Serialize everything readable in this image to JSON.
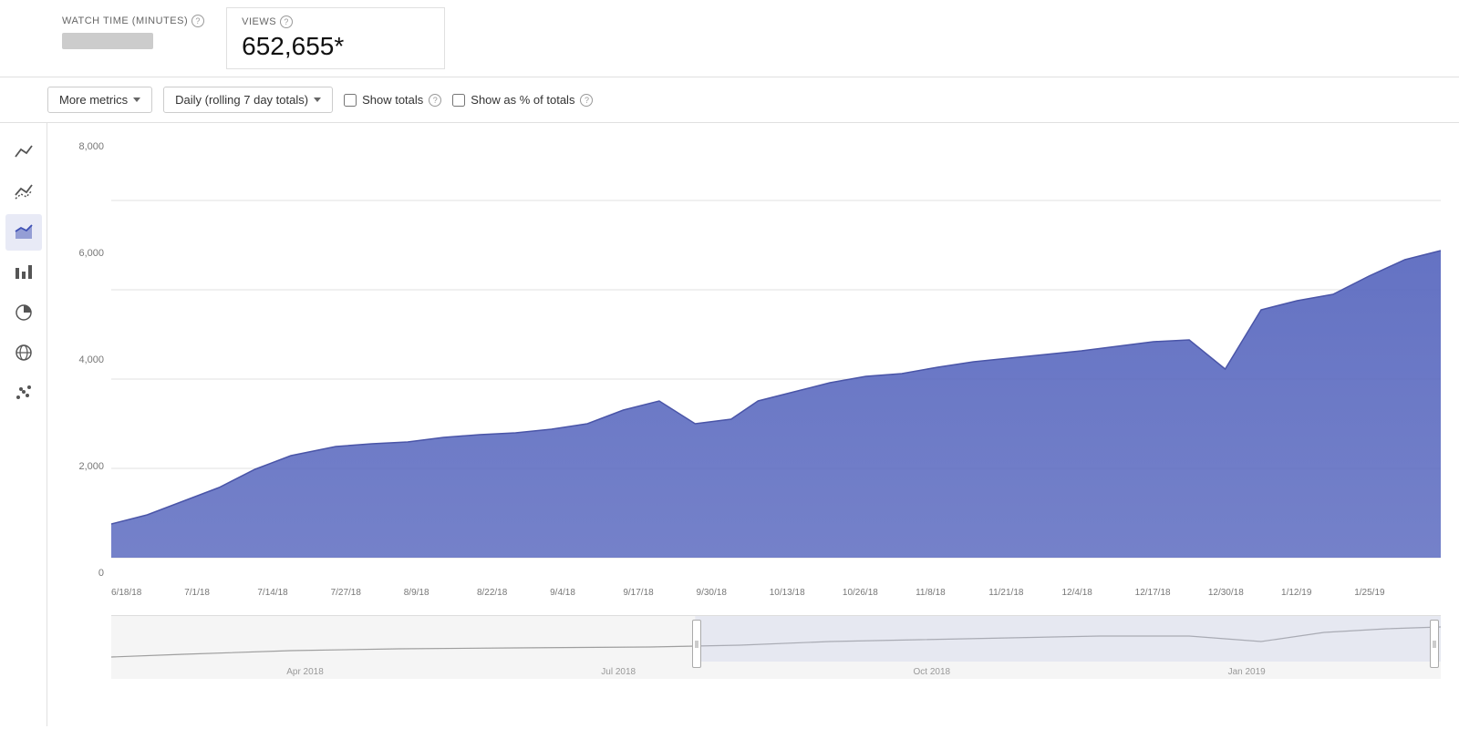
{
  "metrics": {
    "watch_time": {
      "title": "WATCH TIME (MINUTES)",
      "value_placeholder": true
    },
    "views": {
      "title": "VIEWS",
      "value": "652,655*"
    }
  },
  "toolbar": {
    "more_metrics_label": "More metrics",
    "period_label": "Daily (rolling 7 day totals)",
    "show_totals_label": "Show totals",
    "show_as_pct_label": "Show as % of totals"
  },
  "sidebar": {
    "items": [
      {
        "name": "line-chart-icon",
        "symbol": "∿",
        "active": false
      },
      {
        "name": "multi-line-icon",
        "symbol": "≋",
        "active": false
      },
      {
        "name": "area-chart-icon",
        "symbol": "▦",
        "active": true
      },
      {
        "name": "bar-chart-icon",
        "symbol": "≡",
        "active": false
      },
      {
        "name": "pie-chart-icon",
        "symbol": "◕",
        "active": false
      },
      {
        "name": "globe-icon",
        "symbol": "⊕",
        "active": false
      },
      {
        "name": "scatter-icon",
        "symbol": "⁘",
        "active": false
      }
    ]
  },
  "chart": {
    "y_labels": [
      "8,000",
      "6,000",
      "4,000",
      "2,000",
      "0"
    ],
    "x_labels": [
      "6/18/18",
      "7/1/18",
      "7/14/18",
      "7/27/18",
      "8/9/18",
      "8/22/18",
      "9/4/18",
      "9/17/18",
      "9/30/18",
      "10/13/18",
      "10/26/18",
      "11/8/18",
      "11/21/18",
      "12/4/18",
      "12/17/18",
      "12/30/18",
      "1/12/19",
      "1/25/19"
    ],
    "fill_color": "#5c6bc0",
    "fill_opacity": 0.9
  },
  "mini_chart": {
    "labels": [
      "Apr 2018",
      "Jul 2018",
      "Oct 2018",
      "Jan 2019"
    ],
    "handle_left_pct": 44,
    "handle_right_pct": 99
  }
}
